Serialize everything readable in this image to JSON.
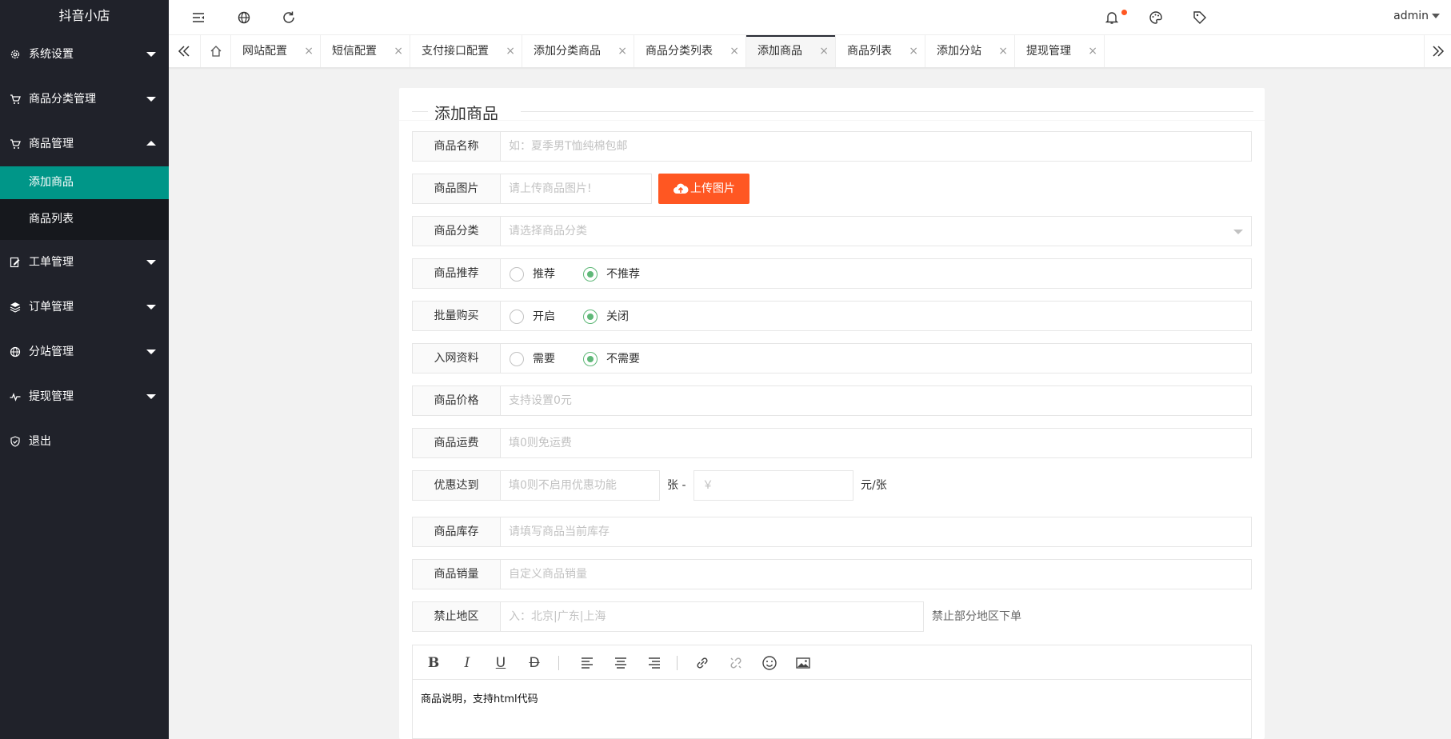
{
  "sidebar": {
    "logo": "抖音小店",
    "items": [
      {
        "label": "系统设置"
      },
      {
        "label": "商品分类管理"
      },
      {
        "label": "商品管理"
      },
      {
        "label": "工单管理"
      },
      {
        "label": "订单管理"
      },
      {
        "label": "分站管理"
      },
      {
        "label": "提现管理"
      },
      {
        "label": "退出"
      }
    ],
    "submenu": [
      {
        "label": "添加商品",
        "active": true
      },
      {
        "label": "商品列表",
        "active": false
      }
    ]
  },
  "topbar": {
    "user": "admin",
    "icons": [
      "menu-toggle-icon",
      "globe-icon",
      "refresh-icon",
      "bell-icon",
      "palette-icon",
      "tag-icon"
    ],
    "accent": "#ff5722"
  },
  "tabs": [
    {
      "label": "网站配置"
    },
    {
      "label": "短信配置"
    },
    {
      "label": "支付接口配置"
    },
    {
      "label": "添加分类商品"
    },
    {
      "label": "商品分类列表"
    },
    {
      "label": "添加商品",
      "active": true
    },
    {
      "label": "商品列表"
    },
    {
      "label": "添加分站"
    },
    {
      "label": "提现管理"
    }
  ],
  "tab_close": "×",
  "form": {
    "title": "添加商品",
    "name": {
      "label": "商品名称",
      "placeholder": "如：夏季男T恤纯棉包邮"
    },
    "image": {
      "label": "商品图片",
      "placeholder": "请上传商品图片!",
      "button": "上传图片"
    },
    "category": {
      "label": "商品分类",
      "placeholder": "请选择商品分类"
    },
    "recommend": {
      "label": "商品推荐",
      "options": [
        "推荐",
        "不推荐"
      ],
      "selected": "不推荐"
    },
    "bulk": {
      "label": "批量购买",
      "options": [
        "开启",
        "关闭"
      ],
      "selected": "关闭"
    },
    "netinfo": {
      "label": "入网资料",
      "options": [
        "需要",
        "不需要"
      ],
      "selected": "不需要"
    },
    "price": {
      "label": "商品价格",
      "placeholder": "支持设置0元"
    },
    "shipping": {
      "label": "商品运费",
      "placeholder": "填0则免运费"
    },
    "discount": {
      "label": "优惠达到",
      "placeholder": "填0则不启用优惠功能",
      "mid": "张 -",
      "price_placeholder": "￥",
      "suffix": "元/张"
    },
    "stock": {
      "label": "商品库存",
      "placeholder": "请填写商品当前库存"
    },
    "sales": {
      "label": "商品销量",
      "placeholder": "自定义商品销量"
    },
    "banned": {
      "label": "禁止地区",
      "placeholder": "入：北京|广东|上海",
      "hint": "禁止部分地区下单"
    },
    "editor": {
      "content": "商品说明，支持html代码"
    }
  },
  "colors": {
    "sidebar": "#20222a",
    "active": "#009688",
    "upload": "#ff5722",
    "radio": "#5fb878"
  }
}
